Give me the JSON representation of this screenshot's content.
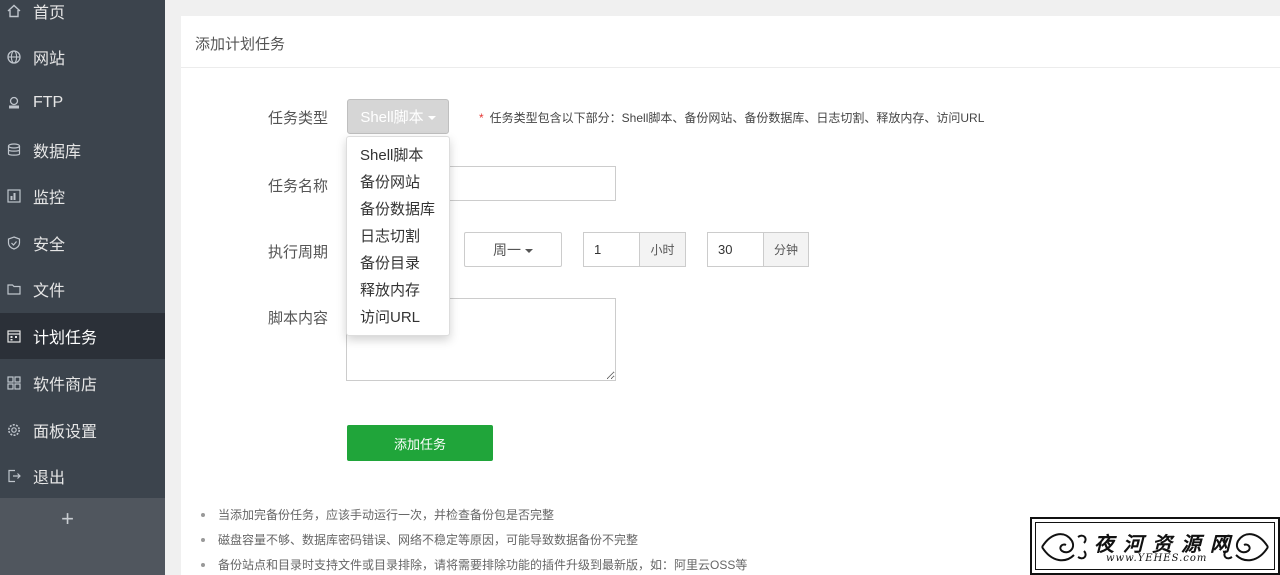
{
  "sidebar": {
    "items": [
      {
        "label": "首页",
        "icon": "home-icon"
      },
      {
        "label": "网站",
        "icon": "globe-icon"
      },
      {
        "label": "FTP",
        "icon": "ftp-icon"
      },
      {
        "label": "数据库",
        "icon": "database-icon"
      },
      {
        "label": "监控",
        "icon": "monitor-icon"
      },
      {
        "label": "安全",
        "icon": "shield-icon"
      },
      {
        "label": "文件",
        "icon": "folder-icon"
      },
      {
        "label": "计划任务",
        "icon": "calendar-icon",
        "active": true
      },
      {
        "label": "软件商店",
        "icon": "grid-icon"
      },
      {
        "label": "面板设置",
        "icon": "gear-icon"
      },
      {
        "label": "退出",
        "icon": "logout-icon"
      }
    ],
    "add_label": "+"
  },
  "panel": {
    "title": "添加计划任务"
  },
  "form": {
    "task_type_label": "任务类型",
    "task_type_value": "Shell脚本",
    "task_type_hint_star": "*",
    "task_type_hint": "任务类型包含以下部分：Shell脚本、备份网站、备份数据库、日志切割、释放内存、访问URL",
    "task_name_label": "任务名称",
    "task_name_value": "",
    "period_label": "执行周期",
    "week_value": "周一",
    "hour_value": "1",
    "hour_unit": "小时",
    "minute_value": "30",
    "minute_unit": "分钟",
    "script_label": "脚本内容",
    "script_value": "",
    "submit_label": "添加任务"
  },
  "dropdown": {
    "options": [
      "Shell脚本",
      "备份网站",
      "备份数据库",
      "日志切割",
      "备份目录",
      "释放内存",
      "访问URL"
    ]
  },
  "notes": [
    "当添加完备份任务，应该手动运行一次，并检查备份包是否完整",
    "磁盘容量不够、数据库密码错误、网络不稳定等原因，可能导致数据备份不完整",
    "备份站点和目录时支持文件或目录排除，请将需要排除功能的插件升级到最新版，如：阿里云OSS等"
  ],
  "watermark": {
    "title": "夜河资源网",
    "url": "www.YEHES.com"
  }
}
